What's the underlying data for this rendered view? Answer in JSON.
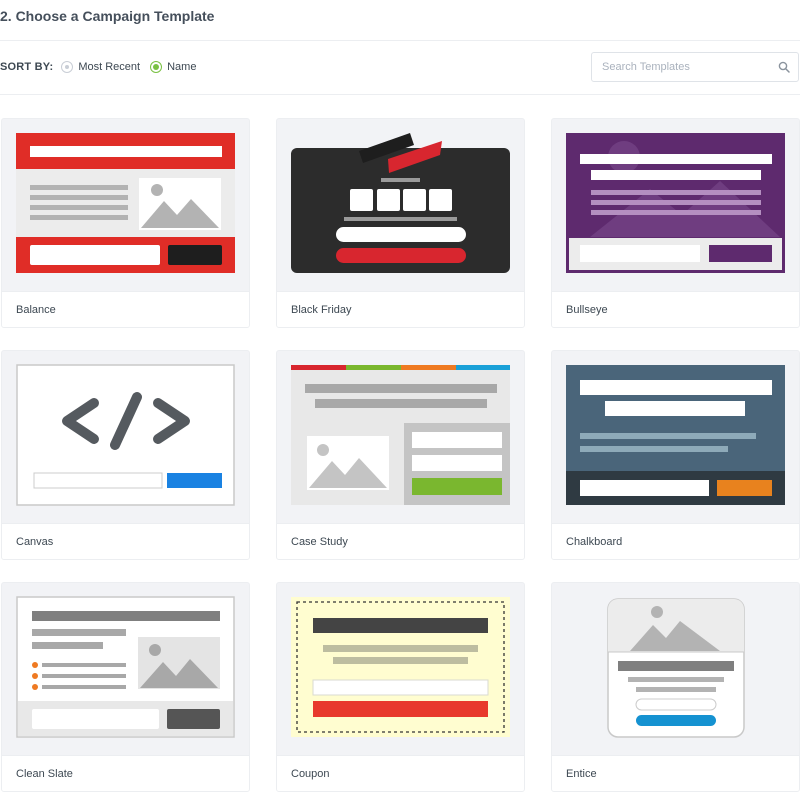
{
  "page": {
    "title": "2. Choose a Campaign Template"
  },
  "sort": {
    "label": "SORT BY:",
    "options": [
      {
        "label": "Most Recent",
        "selected": false
      },
      {
        "label": "Name",
        "selected": true
      }
    ]
  },
  "search": {
    "placeholder": "Search Templates",
    "value": "",
    "icon": "search-icon"
  },
  "templates": [
    {
      "name": "Balance"
    },
    {
      "name": "Black Friday"
    },
    {
      "name": "Bullseye"
    },
    {
      "name": "Canvas"
    },
    {
      "name": "Case Study"
    },
    {
      "name": "Chalkboard"
    },
    {
      "name": "Clean Slate"
    },
    {
      "name": "Coupon"
    },
    {
      "name": "Entice"
    }
  ],
  "colors": {
    "accent_green": "#7ac143",
    "balance_red": "#e02d27",
    "bullseye_purple": "#5e2a6e",
    "canvas_blue": "#1a82e2",
    "chalkboard_slate": "#4a657a",
    "chalkboard_orange": "#e8821e",
    "coupon_yellow": "#fffdd0",
    "coupon_red": "#e8392d",
    "entice_blue": "#1592d1"
  }
}
